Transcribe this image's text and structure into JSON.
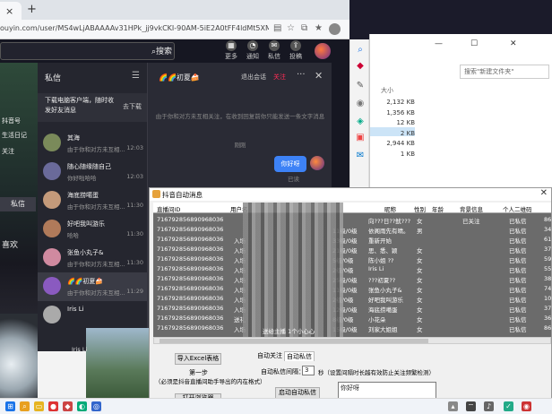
{
  "browser": {
    "url": "ouyin.com/user/MS4wLjABAAAAv31HPk_jj9vkCKI-90AM-5iE2A0tFF4ldMt5XM...",
    "close_tab_glyph": "×",
    "new_tab_glyph": "+"
  },
  "site": {
    "search_button": "搜索",
    "header_items": [
      {
        "label": "更多",
        "icon": "grid-icon"
      },
      {
        "label": "通知",
        "icon": "bell-icon"
      },
      {
        "label": "私信",
        "icon": "message-icon"
      },
      {
        "label": "投稿",
        "icon": "upload-icon"
      }
    ],
    "left_strip": {
      "texts": [
        "抖音号",
        "生活日记",
        "关注"
      ],
      "dm_button": "私信",
      "bottom_text": "喜欢",
      "bottom_text2": "Iris Li"
    }
  },
  "messages": {
    "title": "私信",
    "notice_text": "下载电脑客户端，随时收发好友消息",
    "notice_button": "去下载",
    "conversations": [
      {
        "name": "其海",
        "preview": "由于你和对方未互相...",
        "time": "12:03",
        "color": "#7a8a5a"
      },
      {
        "name": "随心随缘随自己",
        "preview": "你好啦哈哈",
        "time": "12:03",
        "color": "#6a6a9a"
      },
      {
        "name": "海底捞噶蛋",
        "preview": "由于你和对方未互相...",
        "time": "11:30",
        "color": "#c49a7a"
      },
      {
        "name": "好吧我叫游乐",
        "preview": "哈哈",
        "time": "11:30",
        "color": "#b07a5a"
      },
      {
        "name": "张鱼小丸子&",
        "preview": "由于你和对方未互相...",
        "time": "11:30",
        "color": "#d08aa0"
      },
      {
        "name": "🌈🌈初夏🍰",
        "preview": "由于你和对方未互相...",
        "time": "11:29",
        "color": "#8a5ac0"
      },
      {
        "name": "Iris Li",
        "preview": "",
        "time": "",
        "color": "#aaaaaa"
      }
    ]
  },
  "chat": {
    "name": "🌈🌈初夏🍰",
    "exit_label": "退出会话",
    "follow_label": "关注",
    "more_glyph": "···",
    "close_glyph": "✕",
    "system_text": "由于你和对方未互相关注，在收到回复前你只能发送一条文字消息",
    "system_text2": "刚刚",
    "bubble_text": "你好呀",
    "read_status": "已读"
  },
  "explorer": {
    "search_placeholder": "搜索\"新建文件夹\"",
    "column_size": "大小",
    "sizes": [
      "2,132 KB",
      "1,356 KB",
      "12 KB",
      "2 KB",
      "2,944 KB",
      "1 KB"
    ]
  },
  "tool": {
    "title": "抖音自动消息",
    "close_glyph": "✕",
    "headers": [
      "直播间ID",
      "用户名",
      "昵称",
      "性别",
      "年龄",
      "背景信息",
      "个人二维码"
    ],
    "rows": [
      {
        "id": "716792856890968036",
        "c2": "",
        "c3": "",
        "nick": "向???日??鱿???",
        "sex": "女",
        "info": "已关注",
        "status": "已私信",
        "tail": "864"
      },
      {
        "id": "716792856890968036",
        "c2": "",
        "c3": "11级/0级",
        "nick": "依阁雨先有晴。",
        "sex": "男",
        "info": "",
        "status": "已私信",
        "tail": "34"
      },
      {
        "id": "716792856890968036",
        "c2": "入场",
        "c3": "33级/0级",
        "nick": "重新开始",
        "sex": "",
        "info": "",
        "status": "已私信",
        "tail": "614"
      },
      {
        "id": "716792856890968036",
        "c2": "入场",
        "c3": "21级/0级",
        "nick": "思、悉、颖",
        "sex": "女",
        "info": "",
        "status": "已私信",
        "tail": "373"
      },
      {
        "id": "716792856890968036",
        "c2": "入场",
        "c3": "5级/0级",
        "nick": "陈小姐 ??",
        "sex": "女",
        "info": "",
        "status": "已私信",
        "tail": "592"
      },
      {
        "id": "716792856890968036",
        "c2": "入场",
        "c3": "2级/0级",
        "nick": "Iris Li",
        "sex": "女",
        "info": "",
        "status": "已私信",
        "tail": "557"
      },
      {
        "id": "716792856890968036",
        "c2": "入场",
        "c3": "25级/0级",
        "nick": "???初夏??",
        "sex": "女",
        "info": "",
        "status": "已私信",
        "tail": "38780"
      },
      {
        "id": "716792856890968036",
        "c2": "入场",
        "c3": "11级/0级",
        "nick": "张鱼小丸子&",
        "sex": "女",
        "info": "",
        "status": "已私信",
        "tail": "74"
      },
      {
        "id": "716792856890968036",
        "c2": "入场",
        "c3": "2级/0级",
        "nick": "好吧我叫游乐",
        "sex": "女",
        "info": "",
        "status": "已私信",
        "tail": "101"
      },
      {
        "id": "716792856890968036",
        "c2": "入场",
        "c3": "12级/0级",
        "nick": "海底捞噶蛋",
        "sex": "女",
        "info": "",
        "status": "已私信",
        "tail": "372"
      },
      {
        "id": "716792856890968036",
        "c2": "送礼",
        "c3": "8级/0级",
        "nick": "小花朵",
        "sex": "女",
        "info": "",
        "status": "已私信",
        "tail": "367"
      },
      {
        "id": "716792856890968036",
        "c2": "入场",
        "c3": "15级/0级",
        "nick": "刘家大姐姐",
        "sex": "女",
        "info": "",
        "status": "已私信",
        "tail": "86"
      }
    ],
    "gift_note": "送给主播 1个小心心",
    "import_button": "导入Excel表格",
    "step_label": "第一步",
    "step_desc": "（必须是抖音直播间助手导出的内在格式）",
    "open_button": "打开浏览器",
    "tab_follow": "自动关注",
    "tab_dm": "自动私信",
    "interval_label": "自动私信间隔：",
    "interval_value": "3",
    "interval_note": "秒（设置间隔时长越有效防止关注频繁检测）",
    "start_button": "启动自动私信",
    "message_text": "你好呀"
  },
  "taskbar": {
    "icons": [
      "windows-icon",
      "search-icon",
      "explorer-icon",
      "chrome-icon",
      "edge-icon",
      "app-icon"
    ]
  }
}
